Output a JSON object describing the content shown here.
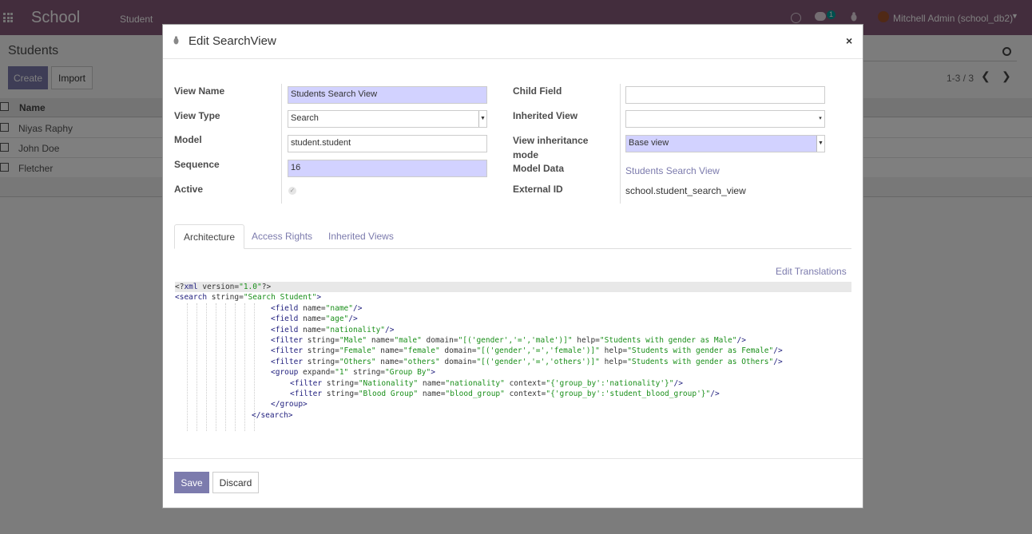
{
  "navbar": {
    "app_name": "School",
    "menu_item": "Student",
    "chat_count": "1",
    "user": "Mitchell Admin (school_db2)"
  },
  "list": {
    "title": "Students",
    "create_label": "Create",
    "import_label": "Import",
    "pager": "1-3 / 3",
    "column_name": "Name",
    "rows": [
      "Niyas Raphy",
      "John Doe",
      "Fletcher"
    ]
  },
  "modal": {
    "title": "Edit SearchView",
    "close": "×",
    "labels": {
      "view_name": "View Name",
      "view_type": "View Type",
      "model": "Model",
      "sequence": "Sequence",
      "active": "Active",
      "child_field": "Child Field",
      "inherited_view": "Inherited View",
      "inheritance_mode_1": "View inheritance",
      "inheritance_mode_2": "mode",
      "model_data": "Model Data",
      "external_id": "External ID"
    },
    "values": {
      "view_name": "Students Search View",
      "view_type": "Search",
      "model": "student.student",
      "sequence": "16",
      "child_field": "",
      "inherited_view": "",
      "inheritance_mode": "Base view",
      "model_data": "Students Search View",
      "external_id": "school.student_search_view"
    },
    "tabs": [
      "Architecture",
      "Access Rights",
      "Inherited Views"
    ],
    "edit_translations": "Edit Translations",
    "save_label": "Save",
    "discard_label": "Discard"
  },
  "colors": {
    "navbar": "#875a7b",
    "primary": "#7c7bad",
    "required_field": "#d2d2ff"
  }
}
